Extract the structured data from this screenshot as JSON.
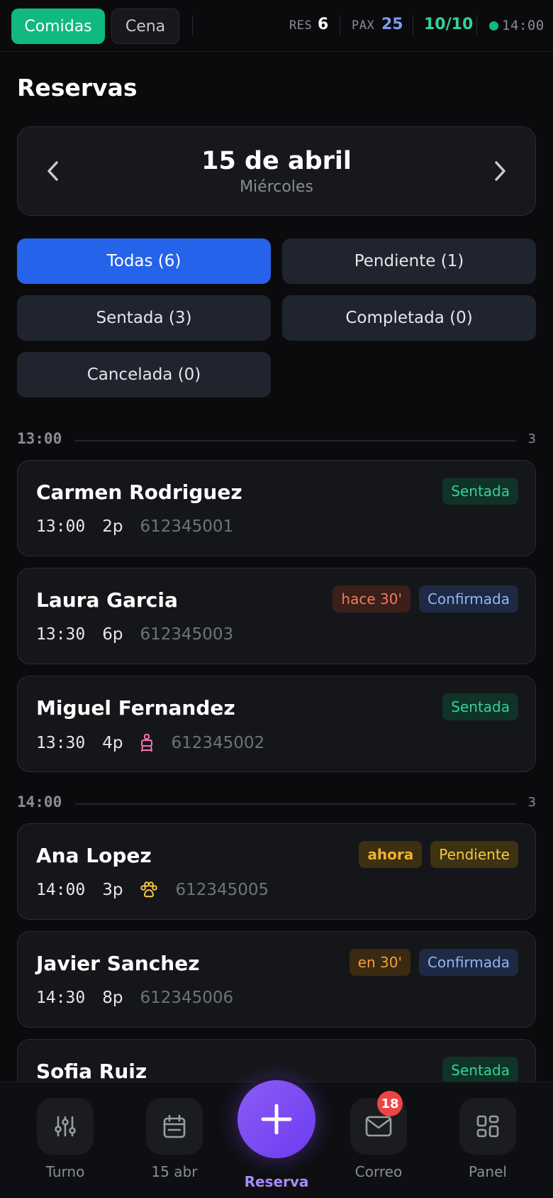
{
  "topbar": {
    "shift_active": "Comidas",
    "shift_inactive": "Cena",
    "res_label": "RES",
    "res_value": "6",
    "pax_label": "PAX",
    "pax_value": "25",
    "capacity": "10/10",
    "clock": "14:00",
    "colors": {
      "accent_green": "#10b981",
      "pax_blue": "#7b9cf0",
      "capacity_green": "#34d399"
    }
  },
  "page": {
    "title": "Reservas"
  },
  "date_nav": {
    "date": "15 de abril",
    "weekday": "Miércoles",
    "prev_icon": "chevron-left-icon",
    "next_icon": "chevron-right-icon"
  },
  "filters": [
    {
      "label": "Todas (6)",
      "active": true
    },
    {
      "label": "Pendiente (1)",
      "active": false
    },
    {
      "label": "Sentada (3)",
      "active": false
    },
    {
      "label": "Completada (0)",
      "active": false
    },
    {
      "label": "Cancelada (0)",
      "active": false
    }
  ],
  "groups": [
    {
      "time": "13:00",
      "count": "3",
      "reservations": [
        {
          "name": "Carmen Rodriguez",
          "time": "13:00",
          "pax": "2p",
          "phone": "612345001",
          "badges": [
            {
              "text": "Sentada",
              "kind": "sentada"
            }
          ]
        },
        {
          "name": "Laura Garcia",
          "time": "13:30",
          "pax": "6p",
          "phone": "612345003",
          "badges": [
            {
              "text": "hace 30'",
              "kind": "red"
            },
            {
              "text": "Confirmada",
              "kind": "confirmada"
            }
          ]
        },
        {
          "name": "Miguel Fernandez",
          "time": "13:30",
          "pax": "4p",
          "phone": "612345002",
          "icon": "baby-chair-icon",
          "badges": [
            {
              "text": "Sentada",
              "kind": "sentada"
            }
          ]
        }
      ]
    },
    {
      "time": "14:00",
      "count": "3",
      "reservations": [
        {
          "name": "Ana Lopez",
          "time": "14:00",
          "pax": "3p",
          "phone": "612345005",
          "icon": "pet-paw-icon",
          "badges": [
            {
              "text": "ahora",
              "kind": "amber"
            },
            {
              "text": "Pendiente",
              "kind": "pendiente"
            }
          ]
        },
        {
          "name": "Javier Sanchez",
          "time": "14:30",
          "pax": "8p",
          "phone": "612345006",
          "badges": [
            {
              "text": "en 30'",
              "kind": "orange"
            },
            {
              "text": "Confirmada",
              "kind": "confirmada"
            }
          ]
        },
        {
          "name": "Sofia Ruiz",
          "badges": [
            {
              "text": "Sentada",
              "kind": "sentada"
            }
          ]
        }
      ]
    }
  ],
  "bottom_nav": {
    "turno": {
      "label": "Turno",
      "icon": "sliders-icon"
    },
    "fecha": {
      "label": "15 abr",
      "icon": "calendar-icon"
    },
    "reserva": {
      "label": "Reserva",
      "icon": "plus-icon"
    },
    "correo": {
      "label": "Correo",
      "icon": "mail-icon",
      "badge": "18"
    },
    "panel": {
      "label": "Panel",
      "icon": "grid-icon"
    }
  }
}
